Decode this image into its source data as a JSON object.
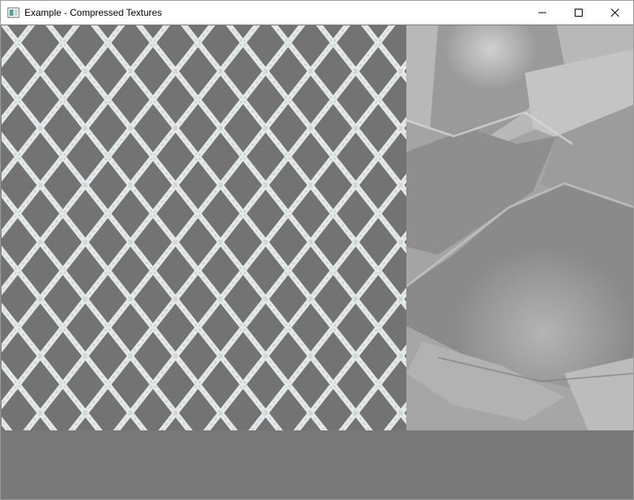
{
  "window": {
    "title": "Example - Compressed Textures",
    "app_icon": "window-app-icon",
    "controls": [
      "minimize-icon",
      "maximize-icon",
      "close-icon"
    ]
  },
  "viewport": {
    "background": "#787878",
    "textures": [
      {
        "name": "chain-link-fence-texture",
        "base_color": "#737373",
        "line_color": "#e6e9e9"
      },
      {
        "name": "rock-surface-texture",
        "base_color": "#a8a8a8"
      }
    ]
  }
}
